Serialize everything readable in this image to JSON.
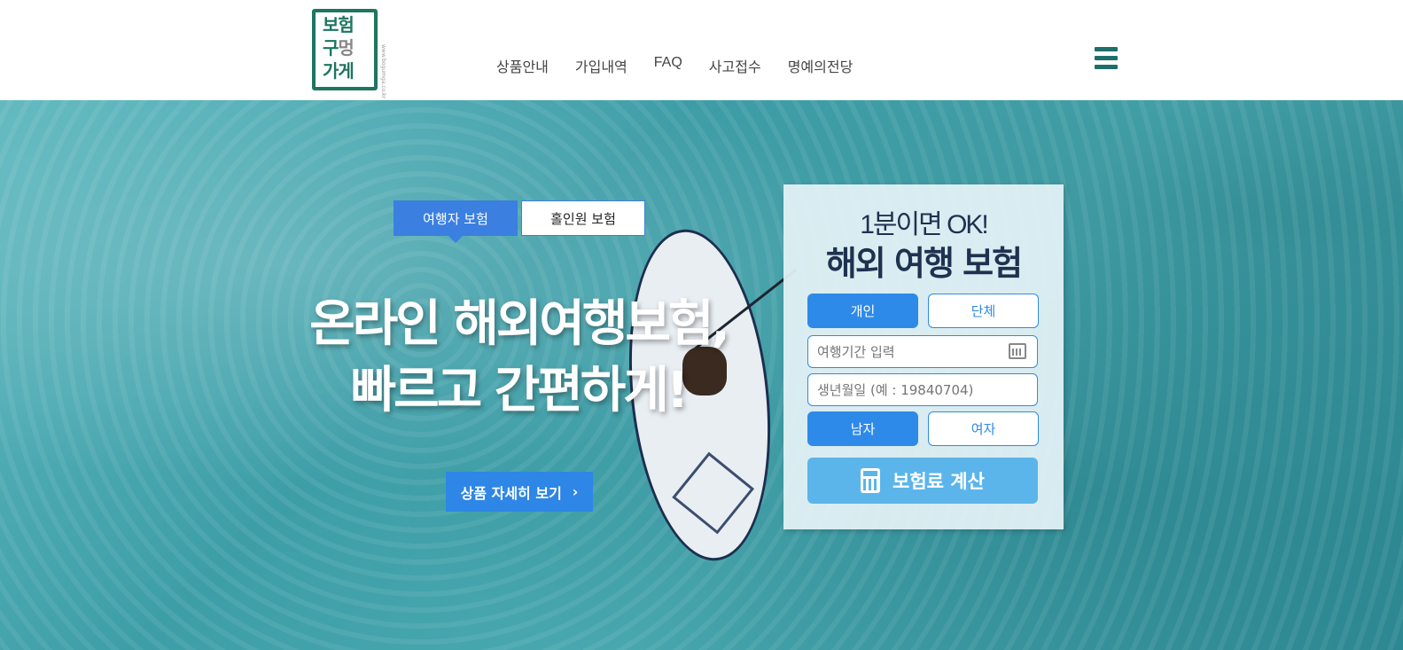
{
  "logo": {
    "line1": "보험",
    "line2a": "구",
    "line2b": "멍",
    "line3": "가게",
    "url": "www.bogumga.co.kr"
  },
  "nav": {
    "items": [
      "상품안내",
      "가입내역",
      "FAQ",
      "사고접수",
      "명예의전당"
    ]
  },
  "hero": {
    "tabs": [
      "여행자 보험",
      "홀인원 보험"
    ],
    "headline_line1": "온라인 해외여행보험,",
    "headline_line2": "빠르고 간편하게!",
    "detail_button": "상품 자세히 보기",
    "detail_arrow": "›"
  },
  "quote_panel": {
    "subtitle": "1분이면 OK!",
    "title": "해외 여행 보험",
    "type_options": [
      "개인",
      "단체"
    ],
    "travel_period_placeholder": "여행기간 입력",
    "birthdate_placeholder": "생년월일 (예 : 19840704)",
    "gender_options": [
      "남자",
      "여자"
    ],
    "calc_button": "보험료 계산"
  },
  "colors": {
    "brand_green": "#1e7560",
    "accent_blue": "#2e8ae8",
    "calc_button": "#5bb5ea",
    "panel_title": "#1e3250"
  },
  "icons": [
    "hamburger-menu-icon",
    "calendar-icon",
    "calculator-icon",
    "chevron-right-icon"
  ]
}
